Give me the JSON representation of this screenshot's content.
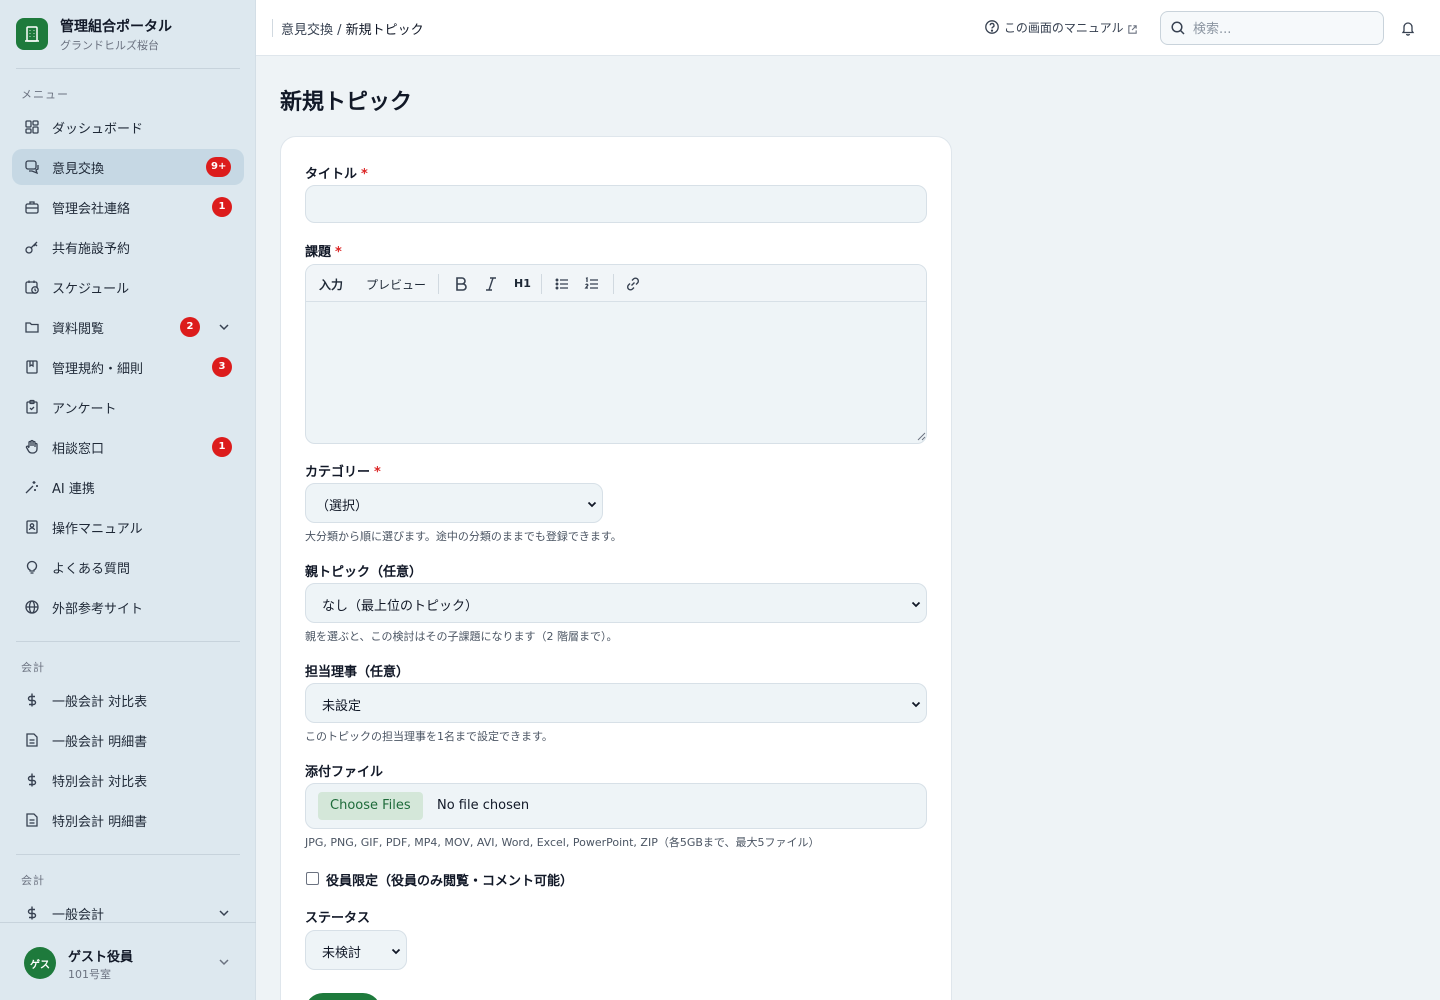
{
  "brand": {
    "title": "管理組合ポータル",
    "subtitle": "グランドヒルズ桜台",
    "color": "#1e7a3c"
  },
  "sidebar": {
    "section_menu": "メニュー",
    "items": [
      {
        "label": "ダッシュボード",
        "icon": "dashboard-icon"
      },
      {
        "label": "意見交換",
        "icon": "chat-icon",
        "badge": "9+",
        "active": true
      },
      {
        "label": "管理会社連絡",
        "icon": "briefcase-icon",
        "badge": "1"
      },
      {
        "label": "共有施設予約",
        "icon": "key-icon"
      },
      {
        "label": "スケジュール",
        "icon": "calendar-clock-icon"
      },
      {
        "label": "資料閲覧",
        "icon": "folder-icon",
        "badge": "2",
        "expandable": true
      },
      {
        "label": "管理規約・細則",
        "icon": "book-icon",
        "badge": "3"
      },
      {
        "label": "アンケート",
        "icon": "clipboard-icon"
      },
      {
        "label": "相談窓口",
        "icon": "hand-icon",
        "badge": "1"
      },
      {
        "label": "AI 連携",
        "icon": "sparkle-icon"
      },
      {
        "label": "操作マニュアル",
        "icon": "manual-icon"
      },
      {
        "label": "よくある質問",
        "icon": "lightbulb-icon"
      },
      {
        "label": "外部参考サイト",
        "icon": "globe-icon"
      }
    ],
    "section_accounting": "会計",
    "accounting_items": [
      {
        "label": "一般会計 対比表",
        "icon": "dollar-icon"
      },
      {
        "label": "一般会計 明細書",
        "icon": "document-icon"
      },
      {
        "label": "特別会計 対比表",
        "icon": "dollar-icon"
      },
      {
        "label": "特別会計 明細書",
        "icon": "document-icon"
      }
    ],
    "section_accounting2": "会計",
    "accounting2_item": {
      "label": "一般会計",
      "icon": "dollar-icon"
    }
  },
  "user": {
    "avatar": "ゲス",
    "name": "ゲスト役員",
    "room": "101号室"
  },
  "topbar": {
    "breadcrumb_parent": "意見交換",
    "breadcrumb_sep": " / ",
    "breadcrumb_current": "新規トピック",
    "manual_link": "この画面のマニュアル",
    "search_placeholder": "検索..."
  },
  "page": {
    "title": "新規トピック"
  },
  "form": {
    "title_label": "タイトル",
    "title_value": "",
    "body_label": "課題",
    "editor_tab_input": "入力",
    "editor_tab_preview": "プレビュー",
    "editor_h1": "H1",
    "category_label": "カテゴリー",
    "category_value": "（選択）",
    "category_help": "大分類から順に選びます。途中の分類のままでも登録できます。",
    "parent_label": "親トピック（任意）",
    "parent_value": "なし（最上位のトピック）",
    "parent_help": "親を選ぶと、この検討はその子課題になります（2 階層まで）。",
    "director_label": "担当理事（任意）",
    "director_value": "未設定",
    "director_help": "このトピックの担当理事を1名まで設定できます。",
    "attach_label": "添付ファイル",
    "attach_button": "Choose Files",
    "attach_status": "No file chosen",
    "attach_help": "JPG, PNG, GIF, PDF, MP4, MOV, AVI, Word, Excel, PowerPoint, ZIP（各5GBまで、最大5ファイル）",
    "officer_only_label": "役員限定（役員のみ閲覧・コメント可能）",
    "officer_only_checked": false,
    "status_label": "ステータス",
    "status_value": "未検討",
    "required_mark": "*"
  },
  "colors": {
    "accent": "#1e7a3c",
    "badge": "#dc1c1c",
    "sidebar_bg": "#dde8ef",
    "page_bg": "#eef3f6"
  }
}
